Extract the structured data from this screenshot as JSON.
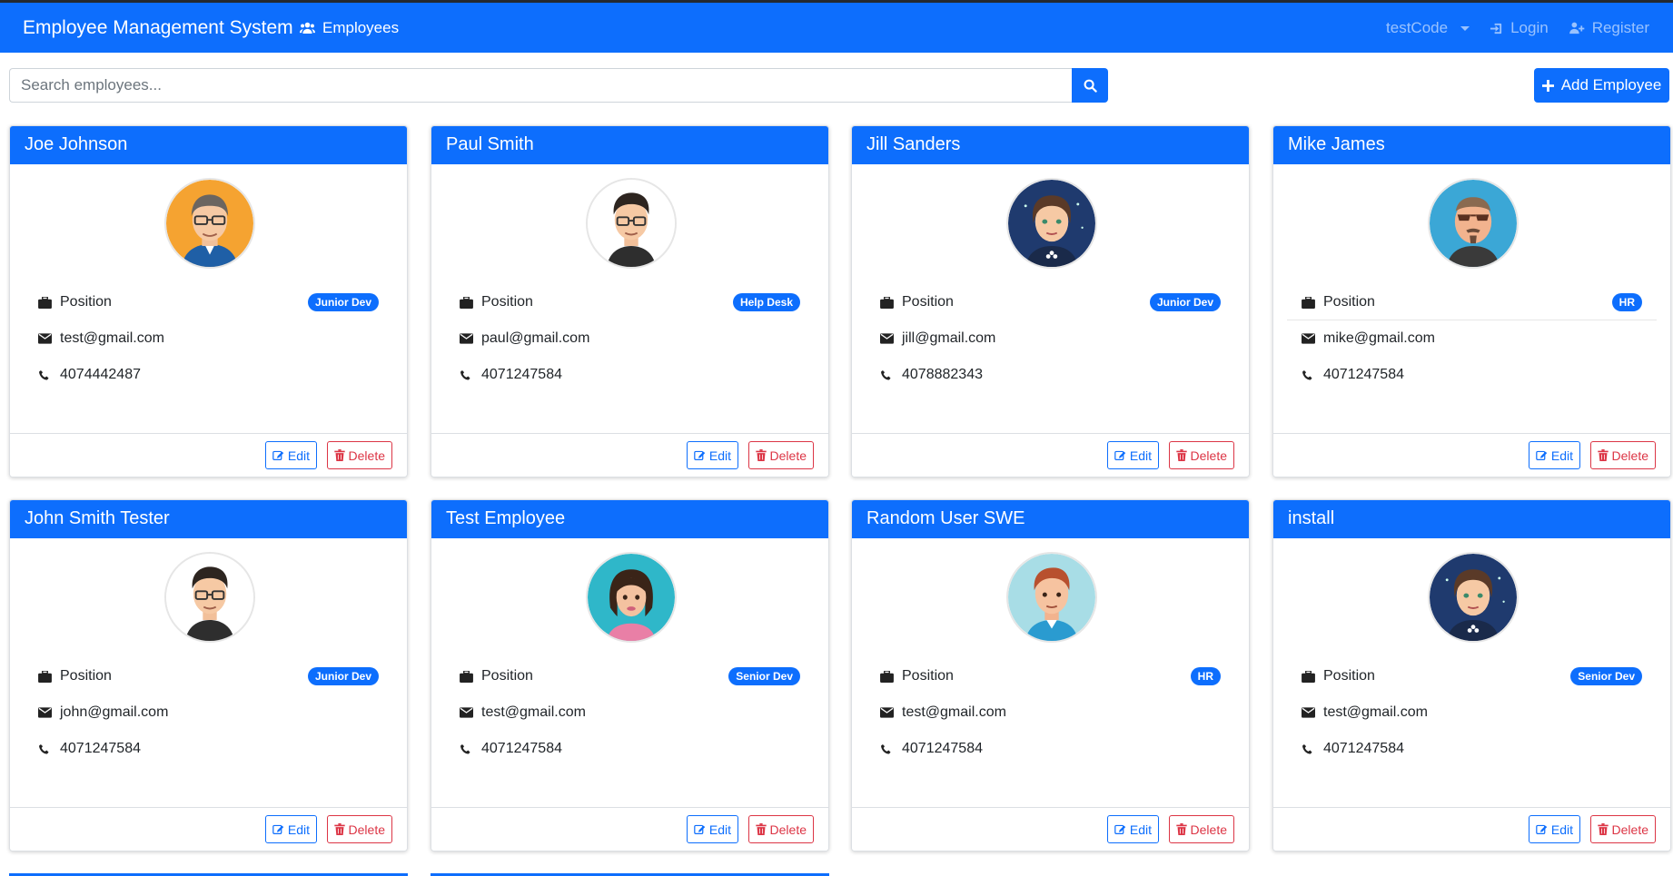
{
  "navbar": {
    "brand": "Employee Management System",
    "employees_link": "Employees",
    "user_menu": "testCode",
    "login": "Login",
    "register": "Register",
    "color": "#0d6efd"
  },
  "search": {
    "placeholder": "Search employees...",
    "value": ""
  },
  "actions": {
    "add_label": "Add Employee",
    "edit_label": "Edit",
    "delete_label": "Delete",
    "position_label": "Position"
  },
  "employees": [
    {
      "name": "Joe Johnson",
      "role": "Junior Dev",
      "email": "test@gmail.com",
      "phone": "4074442487",
      "avatar": "man-glasses-orange-bg"
    },
    {
      "name": "Paul Smith",
      "role": "Help Desk",
      "email": "paul@gmail.com",
      "phone": "4071247584",
      "avatar": "man-glasses-white-bg"
    },
    {
      "name": "Jill Sanders",
      "role": "Junior Dev",
      "email": "jill@gmail.com",
      "phone": "4078882343",
      "avatar": "woman-navy-bg"
    },
    {
      "name": "Mike James",
      "role": "HR",
      "email": "mike@gmail.com",
      "phone": "4071247584",
      "avatar": "man-sunglasses-blue-bg"
    },
    {
      "name": "John Smith Tester",
      "role": "Junior Dev",
      "email": "john@gmail.com",
      "phone": "4071247584",
      "avatar": "man-glasses-white-bg"
    },
    {
      "name": "Test Employee",
      "role": "Senior Dev",
      "email": "test@gmail.com",
      "phone": "4071247584",
      "avatar": "woman-teal-bg"
    },
    {
      "name": "Random User SWE",
      "role": "HR",
      "email": "test@gmail.com",
      "phone": "4071247584",
      "avatar": "man-redhair-light-bg"
    },
    {
      "name": "install",
      "role": "Senior Dev",
      "email": "test@gmail.com",
      "phone": "4071247584",
      "avatar": "woman-navy-bg"
    }
  ],
  "colors": {
    "primary": "#0d6efd",
    "danger": "#dc3545",
    "text": "#212529"
  }
}
